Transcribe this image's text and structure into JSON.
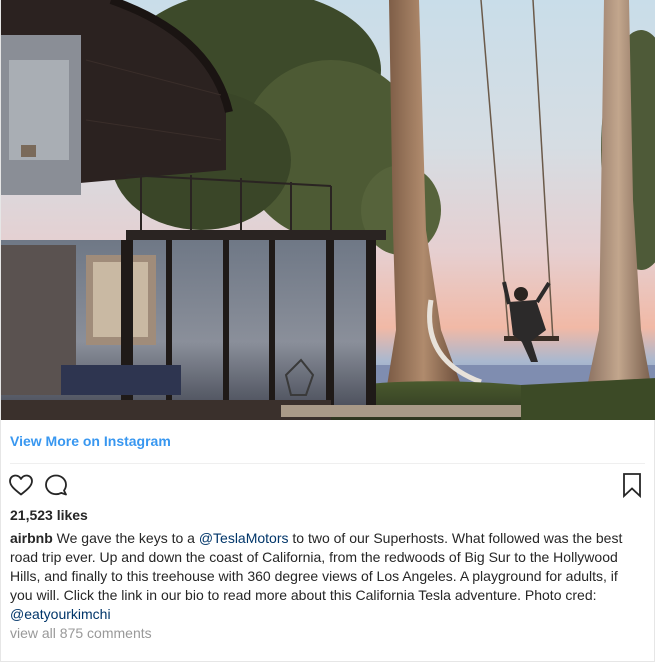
{
  "embed": {
    "view_more_label": "View More on Instagram",
    "likes_text": "21,523 likes",
    "caption": {
      "username": "airbnb",
      "text_part1": " We gave the keys to a ",
      "mention1": "@TeslaMotors",
      "text_part2": " to two of our Superhosts. What followed was the best road trip ever. Up and down the coast of California, from the redwoods of Big Sur to the Hollywood Hills, and finally to this treehouse with 360 degree views of Los Angeles. A playground for adults, if you will. Click the link in our bio to read more about this California Tesla adventure. Photo cred: ",
      "mention2": "@eatyourkimchi"
    },
    "comments_link": "view all 875 comments"
  },
  "icons": {
    "like": "heart-outline-icon",
    "comment": "comment-bubble-icon",
    "save": "bookmark-icon"
  },
  "colors": {
    "link_blue": "#3897f0",
    "mention_blue": "#003569",
    "text": "#262626",
    "muted": "#999999"
  }
}
